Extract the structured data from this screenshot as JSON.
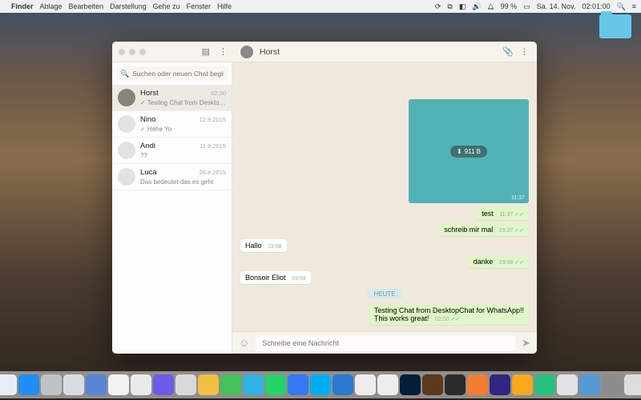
{
  "menubar": {
    "app": "Finder",
    "items": [
      "Ablage",
      "Bearbeiten",
      "Darstellung",
      "Gehe zu",
      "Fenster",
      "Hilfe"
    ],
    "battery": "99 %",
    "date": "Sa. 14. Nov.",
    "time": "02:01:00"
  },
  "chat_header": {
    "name": "Horst"
  },
  "search": {
    "placeholder": "Suchen oder neuen Chat beginnen"
  },
  "chats": [
    {
      "name": "Horst",
      "time": "02:00",
      "preview": "✓ Testing Chat from DesktopChat …",
      "selected": true,
      "avatar": "#8a8478"
    },
    {
      "name": "Nino",
      "time": "12.9.2015",
      "preview": "✓ Hehe Yo",
      "selected": false,
      "avatar": "#e2e2e2"
    },
    {
      "name": "Andi",
      "time": "11.9.2015",
      "preview": "??",
      "selected": false,
      "avatar": "#e2e2e2"
    },
    {
      "name": "Luca",
      "time": "26.8.2015",
      "preview": "Das bedeutet das es geht",
      "selected": false,
      "avatar": "#e2e2e2"
    }
  ],
  "image_msg": {
    "size": "911 B",
    "time": "11:37"
  },
  "messages": [
    {
      "dir": "out",
      "text": "test",
      "time": "11:37",
      "ticks": true
    },
    {
      "dir": "out",
      "text": "schreib mir mal",
      "time": "19:37",
      "ticks": true
    },
    {
      "dir": "in",
      "text": "Hallo",
      "time": "19:58"
    },
    {
      "dir": "out",
      "text": "danke",
      "time": "19:58",
      "ticks": true
    },
    {
      "dir": "in",
      "text": "Bonsoir Eliot",
      "time": "19:59"
    }
  ],
  "date_badge": "HEUTE",
  "latest": {
    "text": "Testing Chat from DesktopChat for WhatsApp!!\nThis works great!",
    "time": "02:00",
    "ticks": true
  },
  "composer": {
    "placeholder": "Schreibe eine Nachricht"
  },
  "dock_colors": [
    "#e9eef4",
    "#1f8df3",
    "#bfc3c7",
    "#d9dde1",
    "#5b84d6",
    "#f2f2f2",
    "#eaeaea",
    "#6c5ce7",
    "#d9d9d9",
    "#f0c040",
    "#45c15a",
    "#2fb3e3",
    "#25d366",
    "#3478f6",
    "#00aff0",
    "#2a78d0",
    "#ededed",
    "#ededed",
    "#031e36",
    "#5a3a1f",
    "#2b2b2b",
    "#f47d32",
    "#312783",
    "#f7aa1b",
    "#26c281",
    "#dfe3e6",
    "#559bd6",
    "#8d8d8d",
    "#dddddd"
  ]
}
